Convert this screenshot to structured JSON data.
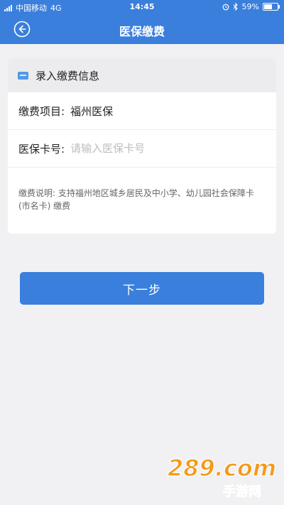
{
  "status_bar": {
    "carrier": "中国移动",
    "network": "4G",
    "time": "14:45",
    "battery_text": "59%",
    "battery_level": 0.59
  },
  "nav": {
    "title": "医保缴费"
  },
  "card": {
    "header_title": "录入缴费信息",
    "item_label": "缴费项目:",
    "item_value": "福州医保",
    "card_no_label": "医保卡号:",
    "card_no_value": "",
    "card_no_placeholder": "请输入医保卡号",
    "note": "缴费说明: 支持福州地区城乡居民及中小学、幼儿园社会保障卡 (市名卡) 缴费"
  },
  "actions": {
    "next_label": "下一步"
  },
  "watermark": {
    "brand": "289.com",
    "caption": "手游网"
  },
  "colors": {
    "primary": "#3a7fdc",
    "page_bg": "#f1f1f3",
    "placeholder": "#bdbdbd",
    "watermark_orange": "#f39a1a"
  }
}
